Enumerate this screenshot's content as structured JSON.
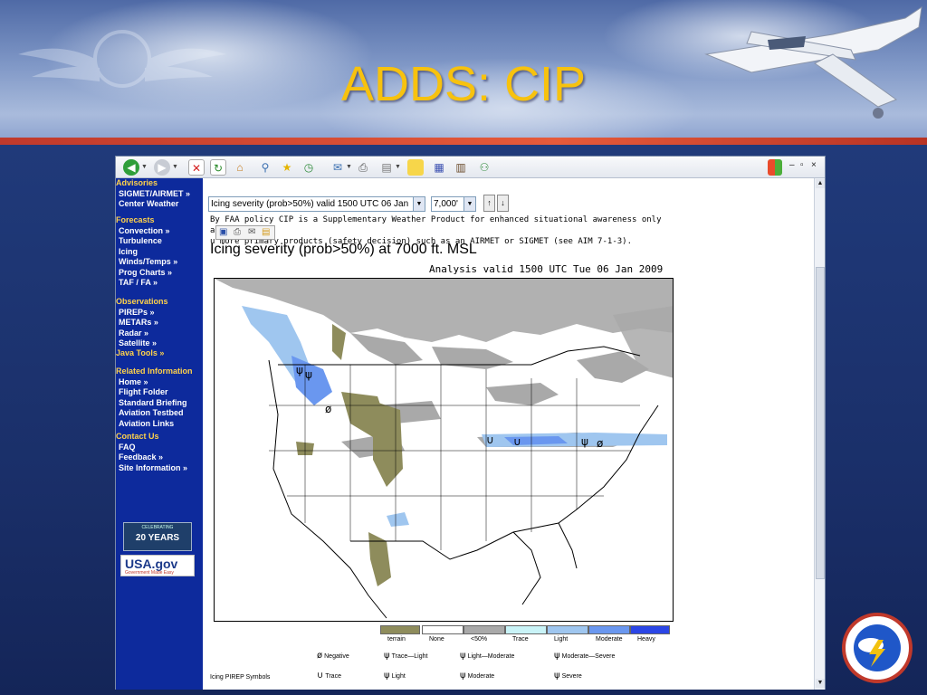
{
  "slide": {
    "title": "ADDS: CIP"
  },
  "colors": {
    "title": "#f7c20e",
    "nav_bg": "#0d2a9c",
    "nav_head": "#ffd24a",
    "terrain": "#8e8c5c",
    "lt50": "#a9a9a9",
    "trace": "#c9f3f7",
    "light": "#9fc6ef",
    "moderate": "#6a97ef",
    "heavy": "#2b46e6"
  },
  "toolbar": {
    "icons": [
      "back-icon",
      "forward-icon",
      "stop-icon",
      "refresh-icon",
      "home-icon",
      "search-icon",
      "favorites-icon",
      "history-icon",
      "mail-icon",
      "print-icon",
      "edit-icon",
      "discuss-icon",
      "messenger-icon",
      "research-icon",
      "people-icon"
    ],
    "win_min": "–",
    "win_restore": "▫",
    "win_close": "×"
  },
  "nav": {
    "groups": [
      {
        "head": "Advisories",
        "items": [
          "SIGMET/AIRMET »",
          "Center Weather"
        ]
      },
      {
        "head": "Forecasts",
        "items": [
          "Convection »",
          "Turbulence",
          "Icing",
          "Winds/Temps »",
          "Prog Charts »",
          "TAF / FA »"
        ]
      },
      {
        "head": "Observations",
        "items": [
          "PIREPs »",
          "METARs »",
          "Radar »",
          "Satellite »"
        ]
      },
      {
        "head": "Java Tools »",
        "items": []
      },
      {
        "head": "Related Information",
        "items": [
          "Home »",
          "Flight Folder",
          "Standard Briefing",
          "Aviation Testbed",
          "Aviation Links"
        ]
      },
      {
        "head": "Contact Us",
        "items": [
          "FAQ",
          "Feedback »",
          "Site Information »"
        ]
      }
    ],
    "badge_years": "20 YEARS",
    "badge_celebrating": "CELEBRATING",
    "badge_usa": "USA.gov",
    "badge_usa_tag": "Government Made Easy"
  },
  "controls": {
    "product_select": "Icing severity (prob>50%) valid 1500 UTC 06 Jan",
    "altitude_select": "7,000'",
    "up_label": "↑",
    "down_label": "↓"
  },
  "disclaimer": {
    "line1": "By FAA policy CIP is a Supplementary Weather Product for enhanced situational awareness only and must be",
    "line2": "u        more primary products (safety decision) such as an AIRMET or SIGMET (see AIM 7-1-3)."
  },
  "map": {
    "title": "Icing severity (prob>50%) at 7000 ft. MSL",
    "subtitle": "Analysis valid 1500 UTC Tue 06 Jan 2009"
  },
  "legend": {
    "items": [
      {
        "label": "terrain",
        "color": "#8e8c5c"
      },
      {
        "label": "None",
        "color": "#ffffff"
      },
      {
        "label": "<50%",
        "color": "#a9a9a9"
      },
      {
        "label": "Trace",
        "color": "#c9f3f7"
      },
      {
        "label": "Light",
        "color": "#9fc6ef"
      },
      {
        "label": "Moderate",
        "color": "#6a97ef"
      },
      {
        "label": "Heavy",
        "color": "#2b46e6"
      }
    ]
  },
  "pirep": {
    "heading": "Icing PIREP Symbols",
    "negative": "Negative",
    "trace_light": "Trace—Light",
    "light_moderate": "Light—Moderate",
    "moderate_severe": "Moderate—Severe",
    "trace": "Trace",
    "light": "Light",
    "moderate": "Moderate",
    "severe": "Severe"
  }
}
